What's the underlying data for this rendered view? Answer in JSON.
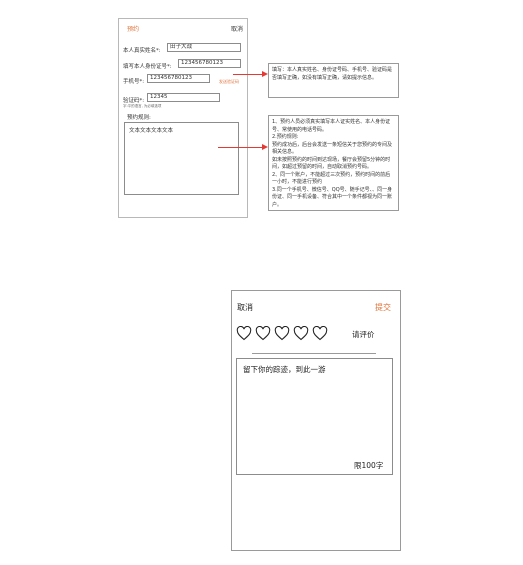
{
  "top_form": {
    "header_left": "预约",
    "header_right": "取消",
    "fields": [
      {
        "label": "本人真实姓名*:",
        "value": "田子大战"
      },
      {
        "label": "填写本人身份证号*:",
        "value": "123456780123"
      },
      {
        "label": "手机号*:",
        "value": "123456780123"
      },
      {
        "label": "验证码*:",
        "value": "12345"
      }
    ],
    "send_code": "发送验证码",
    "code_hint": "字:平的语言, 为必填选项",
    "rules_label": "预约规则:",
    "rules_text": "文本文本文本文本"
  },
  "annotations": {
    "note1": "填写：本人真实姓名、身份证号码、手机号、验证码是否填写正确，如没有填写正确，请如提示信息。",
    "note2": "1、预约人员必须真实填写本人证实姓名、本人身份证号、常使用的电话号码。\n2.预约规则:\n预约成功后，后台会发送一条短信关于您预约的专间及相关信息。\n如未按照预约的时间到达现场，餐厅会预留5分钟的时间，如超过预留的时间，自动取消预约号码。\n2、同一个账户，不能超过三次预约，预约时间的前后一小时，不能进行预约\n3.同一个手机号、微信号、QQ号、随手记号、、同一身份证、同一手机设备、符合其中一个条件都视为同一账户。"
  },
  "review": {
    "cancel": "取消",
    "submit": "提交",
    "rate_label": "请评价",
    "star_count": 5,
    "placeholder": "留下你的踪迹，到此一游",
    "limit": "限100字"
  },
  "colors": {
    "accent": "#e0733a",
    "arrow": "#e53935",
    "border": "#9a9a9a"
  },
  "icons": {
    "rating": "heart-outline-icon"
  }
}
